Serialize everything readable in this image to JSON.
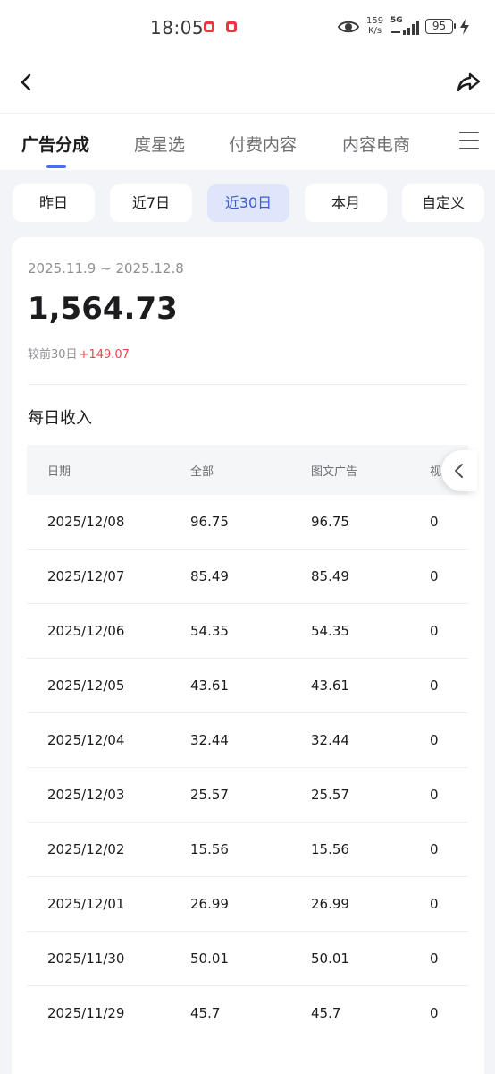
{
  "status_bar": {
    "time": "18:05",
    "net_speed_value": "159",
    "net_speed_unit": "K/s",
    "network": "5G",
    "battery": "95"
  },
  "tabs": [
    {
      "label": "广告分成",
      "active": true
    },
    {
      "label": "度星选",
      "active": false
    },
    {
      "label": "付费内容",
      "active": false
    },
    {
      "label": "内容电商",
      "active": false
    }
  ],
  "filters": [
    {
      "label": "昨日",
      "active": false
    },
    {
      "label": "近7日",
      "active": false
    },
    {
      "label": "近30日",
      "active": true
    },
    {
      "label": "本月",
      "active": false
    },
    {
      "label": "自定义",
      "active": false
    }
  ],
  "summary": {
    "date_range": "2025.11.9 ~ 2025.12.8",
    "total": "1,564.73",
    "compare_label": "较前30日",
    "compare_delta": "+149.07"
  },
  "daily": {
    "title": "每日收入",
    "columns": [
      "日期",
      "全部",
      "图文广告",
      "视"
    ],
    "rows": [
      [
        "2025/12/08",
        "96.75",
        "96.75",
        "0"
      ],
      [
        "2025/12/07",
        "85.49",
        "85.49",
        "0"
      ],
      [
        "2025/12/06",
        "54.35",
        "54.35",
        "0"
      ],
      [
        "2025/12/05",
        "43.61",
        "43.61",
        "0"
      ],
      [
        "2025/12/04",
        "32.44",
        "32.44",
        "0"
      ],
      [
        "2025/12/03",
        "25.57",
        "25.57",
        "0"
      ],
      [
        "2025/12/02",
        "15.56",
        "15.56",
        "0"
      ],
      [
        "2025/12/01",
        "26.99",
        "26.99",
        "0"
      ],
      [
        "2025/11/30",
        "50.01",
        "50.01",
        "0"
      ],
      [
        "2025/11/29",
        "45.7",
        "45.7",
        "0"
      ]
    ]
  },
  "colors": {
    "accent": "#4c6ef5",
    "active_chip_bg": "#dfe5fb",
    "positive_delta": "#e5484d",
    "page_bg": "#f3f4f8"
  },
  "icons": {
    "back": "chevron-left-icon",
    "share": "share-arrow-icon",
    "menu": "hamburger-menu-icon",
    "scroll": "chevron-left-icon"
  }
}
